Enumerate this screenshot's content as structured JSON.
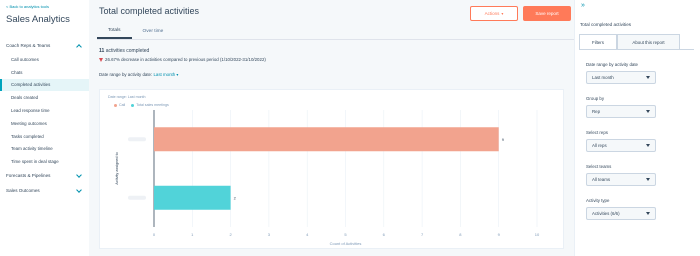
{
  "sidebar": {
    "back_link": "< Back to analytics tools",
    "title": "Sales Analytics",
    "nav": [
      {
        "type": "group",
        "label": "Coach Reps & Teams",
        "expanded": true
      },
      {
        "type": "item",
        "label": "Call outcomes"
      },
      {
        "type": "item",
        "label": "Chats"
      },
      {
        "type": "item",
        "label": "Completed activities",
        "active": true
      },
      {
        "type": "item",
        "label": "Deals created"
      },
      {
        "type": "item",
        "label": "Lead response time"
      },
      {
        "type": "item",
        "label": "Meeting outcomes"
      },
      {
        "type": "item",
        "label": "Tasks completed"
      },
      {
        "type": "item",
        "label": "Team activity timeline"
      },
      {
        "type": "item",
        "label": "Time spent in deal stage"
      },
      {
        "type": "group",
        "label": "Forecasts & Pipelines",
        "expanded": false
      },
      {
        "type": "group",
        "label": "Sales Outcomes",
        "expanded": false
      }
    ]
  },
  "header": {
    "title": "Total completed activities",
    "actions_label": "Actions",
    "save_label": "Save report"
  },
  "tabs": [
    {
      "label": "Totals",
      "active": true
    },
    {
      "label": "Over time",
      "active": false
    }
  ],
  "summary": {
    "count": "11",
    "count_suffix": "activities completed",
    "delta_text": "26.67% decrease in activities compared to previous period (1/10/2022-31/10/2022)"
  },
  "date_filter": {
    "label": "Date range by activity date:",
    "value": "Last month"
  },
  "legend": {
    "title": "Date range: Last month",
    "items": [
      {
        "label": "Call",
        "color": "#f2a38e"
      },
      {
        "label": "Total sales meetings",
        "color": "#51d3d9"
      }
    ]
  },
  "chart_data": {
    "type": "bar",
    "orientation": "horizontal",
    "categories": [
      "",
      ""
    ],
    "series": [
      {
        "name": "Call",
        "values": [
          9
        ],
        "color": "#f2a38e"
      },
      {
        "name": "Total sales meetings",
        "values": [
          2
        ],
        "color": "#51d3d9"
      }
    ],
    "bars": [
      {
        "series": "Call",
        "value": 9,
        "label": "9",
        "color": "#f2a38e"
      },
      {
        "series": "Total sales meetings",
        "value": 2,
        "label": "2",
        "color": "#51d3d9"
      }
    ],
    "xlabel": "Count of Activities",
    "ylabel": "Activity assigned to",
    "xlim": [
      0,
      10
    ],
    "xticks": [
      0,
      1,
      2,
      3,
      4,
      5,
      6,
      7,
      8,
      9,
      10
    ],
    "grid": true
  },
  "right_panel": {
    "title": "Total completed activities",
    "tabs": [
      {
        "label": "Filters",
        "active": true
      },
      {
        "label": "About this report",
        "active": false
      }
    ],
    "filters": [
      {
        "label": "Date range by activity date",
        "value": "Last month"
      },
      {
        "label": "Group by",
        "value": "Rep"
      },
      {
        "label": "Select reps",
        "value": "All reps"
      },
      {
        "label": "Select teams",
        "value": "All teams"
      },
      {
        "label": "Activity type",
        "value": "Activities (6/6)"
      }
    ]
  }
}
